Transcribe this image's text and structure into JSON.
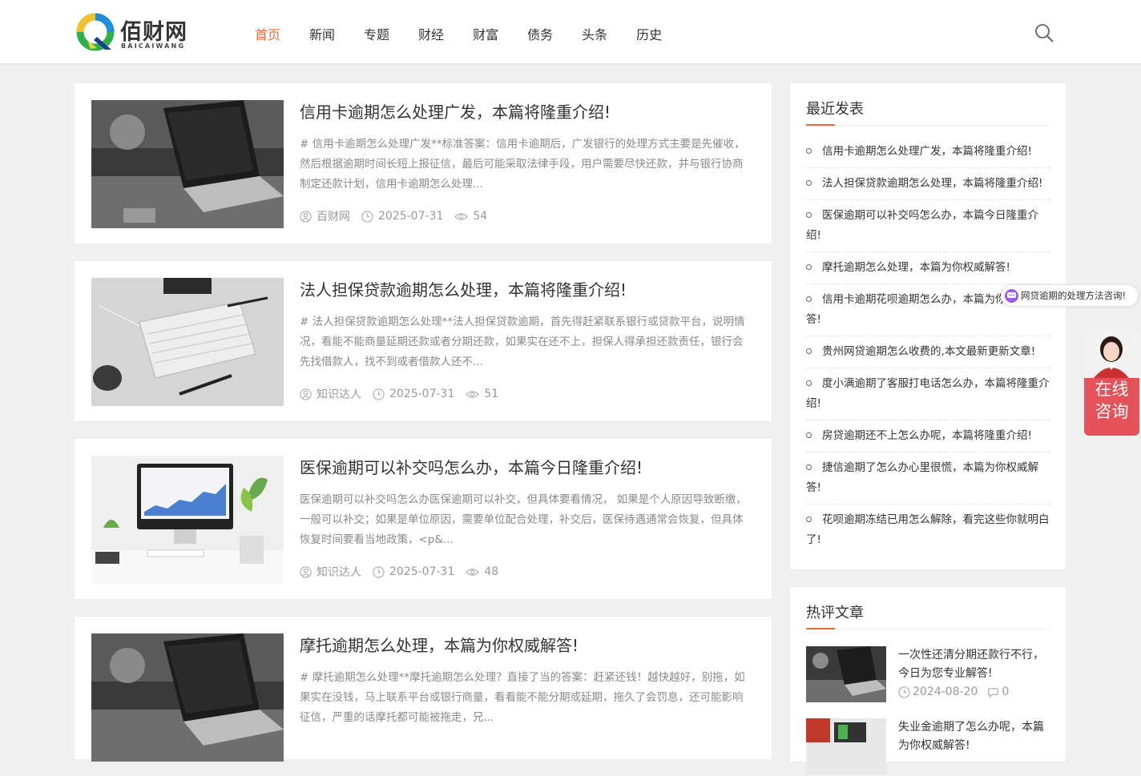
{
  "header": {
    "logo_cn": "佰财网",
    "logo_en": "BAICAIWANG",
    "nav": [
      "首页",
      "新闻",
      "专题",
      "财经",
      "财富",
      "债务",
      "头条",
      "历史"
    ],
    "active_nav": "首页"
  },
  "articles": [
    {
      "title": "信用卡逾期怎么处理广发，本篇将隆重介绍!",
      "excerpt": "# 信用卡逾期怎么处理广发**标准答案：信用卡逾期后，广发银行的处理方式主要是先催收，然后根据逾期时间长短上报征信，最后可能采取法律手段，用户需要尽快还款，并与银行协商制定还款计划，信用卡逾期怎么处理...",
      "author": "百财网",
      "date": "2025-07-31",
      "views": "54"
    },
    {
      "title": "法人担保贷款逾期怎么处理，本篇将隆重介绍!",
      "excerpt": "# 法人担保贷款逾期怎么处理**法人担保贷款逾期，首先得赶紧联系银行或贷款平台，说明情况，看能不能商量延期还款或者分期还款，如果实在还不上，担保人得承担还款责任，银行会先找借款人，找不到或者借款人还不...",
      "author": "知识达人",
      "date": "2025-07-31",
      "views": "51"
    },
    {
      "title": "医保逾期可以补交吗怎么办，本篇今日隆重介绍!",
      "excerpt": "医保逾期可以补交吗怎么办医保逾期可以补交，但具体要看情况， 如果是个人原因导致断缴，一般可以补交；如果是单位原因，需要单位配合处理，补交后，医保待遇通常会恢复，但具体恢复时间要看当地政策，<p&...",
      "author": "知识达人",
      "date": "2025-07-31",
      "views": "48"
    },
    {
      "title": "摩托逾期怎么处理，本篇为你权威解答!",
      "excerpt": "# 摩托逾期怎么处理**摩托逾期怎么处理？直接了当的答案：赶紧还钱！越快越好，别拖，如果实在没钱，马上联系平台或银行商量，看看能不能分期或延期，拖久了会罚息，还可能影响征信，严重的话摩托都可能被拖走，兄...",
      "author": "",
      "date": "",
      "views": ""
    }
  ],
  "sidebar": {
    "recent_title": "最近发表",
    "recent": [
      "信用卡逾期怎么处理广发，本篇将隆重介绍!",
      "法人担保贷款逾期怎么处理，本篇将隆重介绍!",
      "医保逾期可以补交吗怎么办，本篇今日隆重介绍!",
      "摩托逾期怎么处理，本篇为你权威解答!",
      "信用卡逾期花呗逾期怎么办，本篇为你权威解答!",
      "贵州网贷逾期怎么收费的,本文最新更新文章!",
      "度小满逾期了客服打电话怎么办，本篇将隆重介绍!",
      "房贷逾期还不上怎么办呢，本篇将隆重介绍!",
      "捷信逾期了怎么办心里很慌，本篇为你权威解答!",
      "花呗逾期冻结已用怎么解除，看完这些你就明白了!"
    ],
    "hot_title": "热评文章",
    "hot": [
      {
        "title": "一次性还清分期还款行不行，今日为您专业解答!",
        "date": "2024-08-20",
        "comments": "0"
      },
      {
        "title": "失业金逾期了怎么办呢，本篇为你权威解答!",
        "date": "",
        "comments": ""
      }
    ]
  },
  "chat": {
    "bubble": "网贷逾期的处理方法咨询!",
    "consult_line1": "在线",
    "consult_line2": "咨询"
  },
  "colors": {
    "accent": "#e6693b",
    "consult": "#e7525a",
    "chat_dot": "#9a5fe6"
  }
}
